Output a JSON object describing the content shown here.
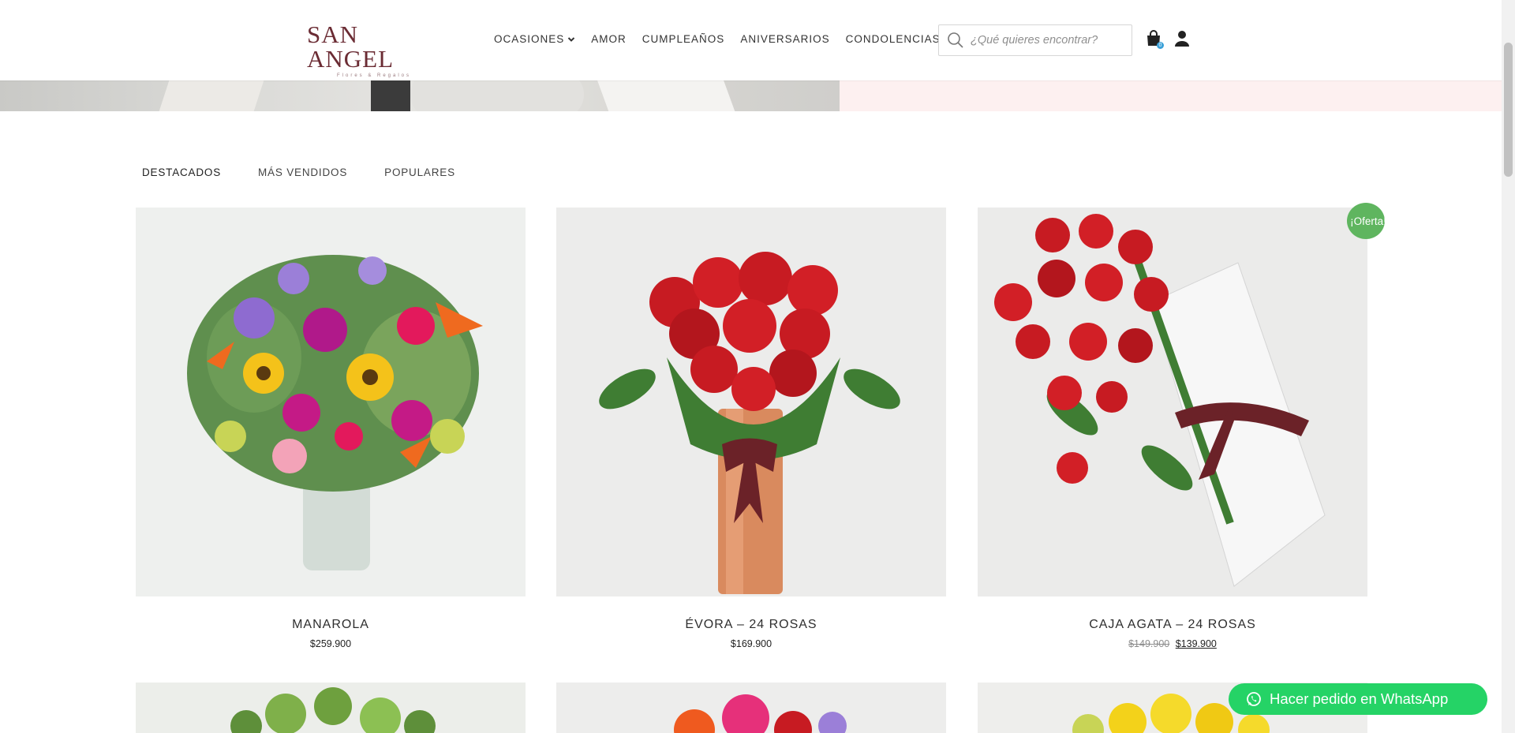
{
  "header": {
    "logo": {
      "name": "SAN ANGEL",
      "tagline": "Flores & Regalos"
    },
    "nav": [
      {
        "label": "OCASIONES",
        "has_dropdown": true
      },
      {
        "label": "AMOR"
      },
      {
        "label": "CUMPLEAÑOS"
      },
      {
        "label": "ANIVERSARIOS"
      },
      {
        "label": "CONDOLENCIAS"
      }
    ],
    "search": {
      "placeholder": "¿Qué quieres encontrar?"
    },
    "cart": {
      "count": "0"
    }
  },
  "tabs": [
    {
      "label": "DESTACADOS",
      "active": true
    },
    {
      "label": "MÁS VENDIDOS"
    },
    {
      "label": "POPULARES"
    }
  ],
  "products": [
    {
      "name": "MANAROLA",
      "price": "$259.900",
      "image": "flower-arrangement-image"
    },
    {
      "name": "ÉVORA – 24 ROSAS",
      "price": "$169.900",
      "image": "roses-vase-image"
    },
    {
      "name": "CAJA AGATA – 24 ROSAS",
      "old_price": "$149.900",
      "price": "$139.900",
      "image": "roses-box-image",
      "badge": "¡Oferta!"
    }
  ],
  "whatsapp": {
    "label": "Hacer pedido en WhatsApp"
  },
  "colors": {
    "brand": "#6b2c34",
    "sale_badge": "#5fb55f",
    "whatsapp": "#25d366",
    "hero_pink": "#fdf0f0"
  }
}
